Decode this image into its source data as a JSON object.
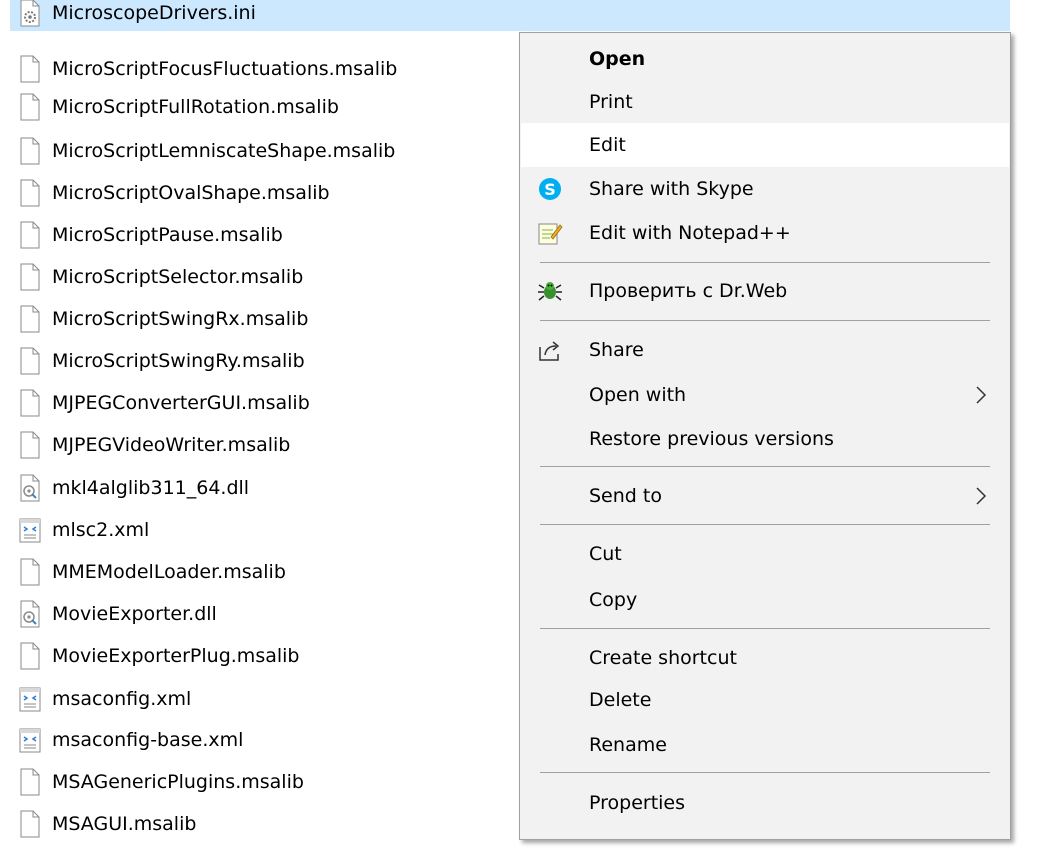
{
  "files": [
    {
      "name": "MicroscopeDrivers.ini",
      "icon": "ini-file-icon",
      "selected": true
    },
    {
      "name": "MicroScriptFocusFluctuations.msalib",
      "icon": "blank-file-icon"
    },
    {
      "name": "MicroScriptFullRotation.msalib",
      "icon": "blank-file-icon"
    },
    {
      "name": "MicroScriptLemniscateShape.msalib",
      "icon": "blank-file-icon"
    },
    {
      "name": "MicroScriptOvalShape.msalib",
      "icon": "blank-file-icon"
    },
    {
      "name": "MicroScriptPause.msalib",
      "icon": "blank-file-icon"
    },
    {
      "name": "MicroScriptSelector.msalib",
      "icon": "blank-file-icon"
    },
    {
      "name": "MicroScriptSwingRx.msalib",
      "icon": "blank-file-icon"
    },
    {
      "name": "MicroScriptSwingRy.msalib",
      "icon": "blank-file-icon"
    },
    {
      "name": "MJPEGConverterGUI.msalib",
      "icon": "blank-file-icon"
    },
    {
      "name": "MJPEGVideoWriter.msalib",
      "icon": "blank-file-icon"
    },
    {
      "name": "mkl4alglib311_64.dll",
      "icon": "dll-file-icon"
    },
    {
      "name": "mlsc2.xml",
      "icon": "xml-file-icon"
    },
    {
      "name": "MMEModelLoader.msalib",
      "icon": "blank-file-icon"
    },
    {
      "name": "MovieExporter.dll",
      "icon": "dll-file-icon"
    },
    {
      "name": "MovieExporterPlug.msalib",
      "icon": "blank-file-icon"
    },
    {
      "name": "msaconfig.xml",
      "icon": "xml-file-icon"
    },
    {
      "name": "msaconfig-base.xml",
      "icon": "xml-file-icon"
    },
    {
      "name": "MSAGenericPlugins.msalib",
      "icon": "blank-file-icon"
    },
    {
      "name": "MSAGUI.msalib",
      "icon": "blank-file-icon"
    }
  ],
  "context_menu": {
    "open": "Open",
    "print": "Print",
    "edit": "Edit",
    "share_skype": "Share with Skype",
    "edit_notepad": "Edit with Notepad++",
    "drweb_check": "Проверить с Dr.Web",
    "share": "Share",
    "open_with": "Open with",
    "restore_versions": "Restore previous versions",
    "send_to": "Send to",
    "cut": "Cut",
    "copy": "Copy",
    "create_shortcut": "Create shortcut",
    "delete": "Delete",
    "rename": "Rename",
    "properties": "Properties",
    "hovered_item": "Edit"
  },
  "colors": {
    "selection": "#cce8ff",
    "menu_background": "#f2f2f2",
    "menu_hover": "#ffffff",
    "separator": "#a0a0a0",
    "skype": "#00aff0"
  }
}
